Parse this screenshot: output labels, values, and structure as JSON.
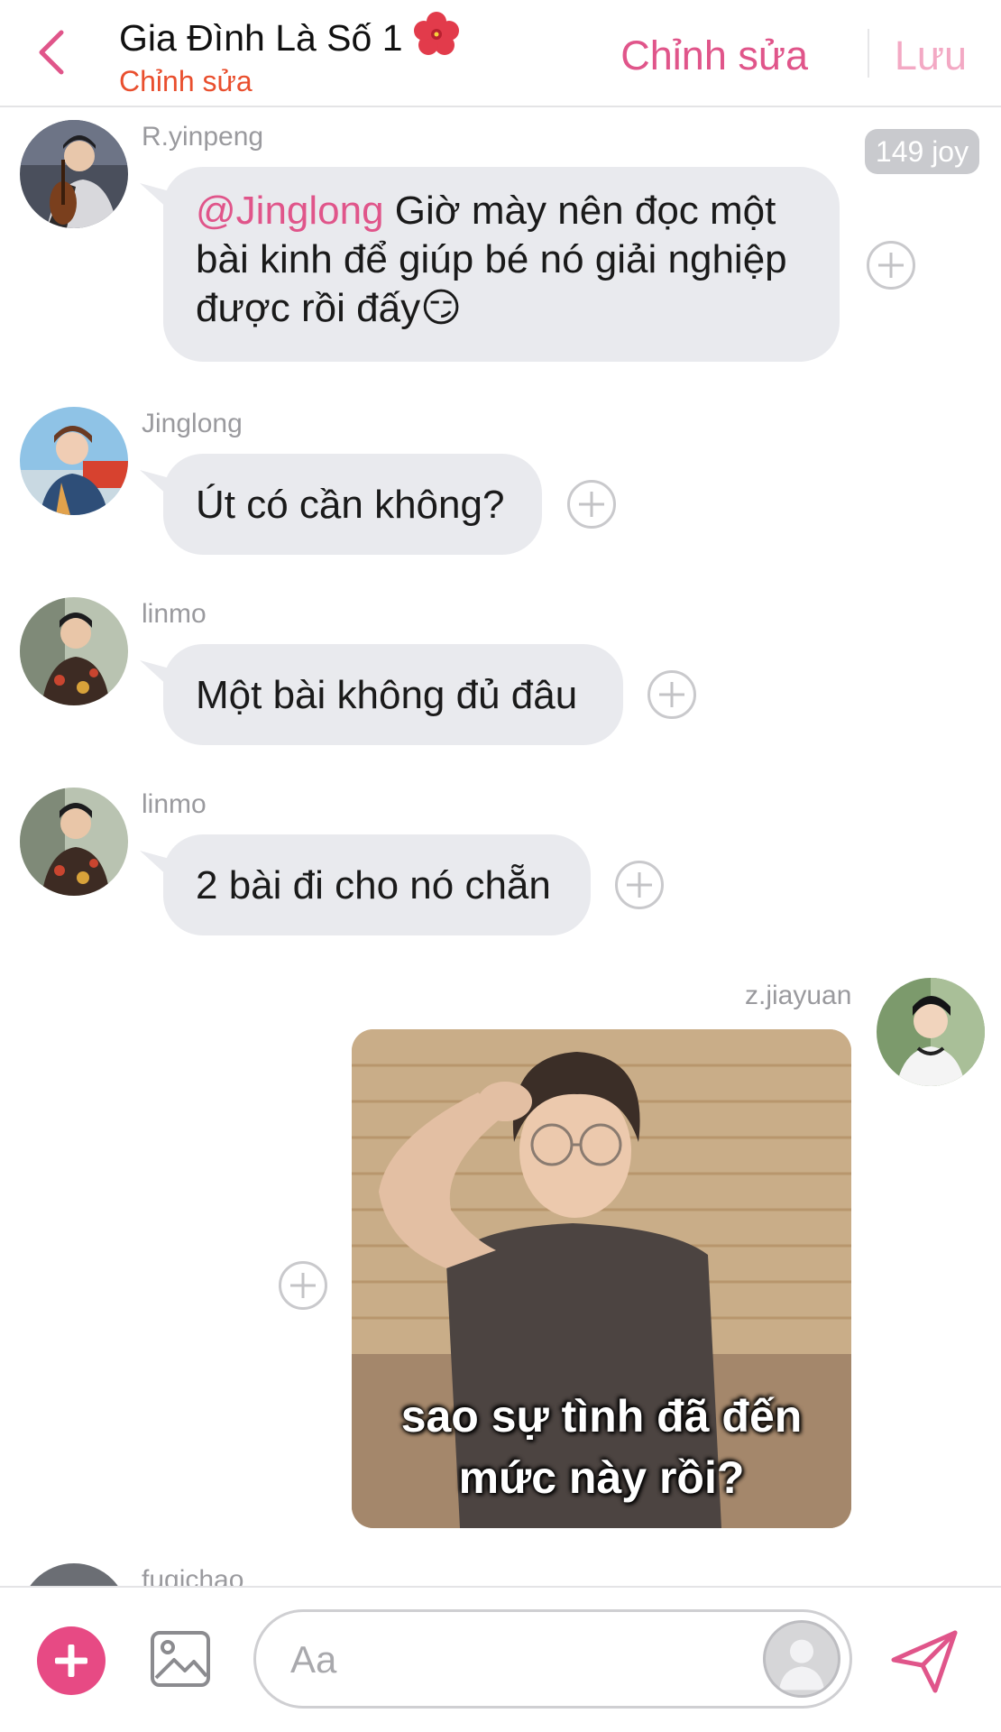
{
  "header": {
    "title": "Gia Đình Là Số 1",
    "subtitle": "Chỉnh sửa",
    "edit_label": "Chỉnh sửa",
    "save_label": "Lưu"
  },
  "messages": [
    {
      "user": "R.yinpeng",
      "mention": "@Jinglong",
      "text": " Giờ mày nên đọc một bài kinh để giúp bé nó giải nghiệp được rồi đấy😏",
      "badge": "149 joy"
    },
    {
      "user": "Jinglong",
      "text": "Út có cần không?"
    },
    {
      "user": "linmo",
      "text": "Một bài không đủ đâu"
    },
    {
      "user": "linmo",
      "text": "2 bài đi cho nó chẵn"
    },
    {
      "user": "z.jiayuan",
      "image_caption": [
        "sao sự tình đã đến",
        "mức này rồi?"
      ]
    },
    {
      "user": "fuqichao"
    }
  ],
  "composer": {
    "placeholder": "Aa"
  },
  "colors": {
    "accent": "#e0558a",
    "subtitle": "#e94f2e",
    "bubble": "#e9eaee",
    "add_button": "#e74a84"
  },
  "icons": [
    "back-chevron-icon",
    "hibiscus-icon",
    "add-icon",
    "image-icon",
    "avatar-placeholder-icon",
    "send-icon",
    "plus-reaction-icon"
  ]
}
